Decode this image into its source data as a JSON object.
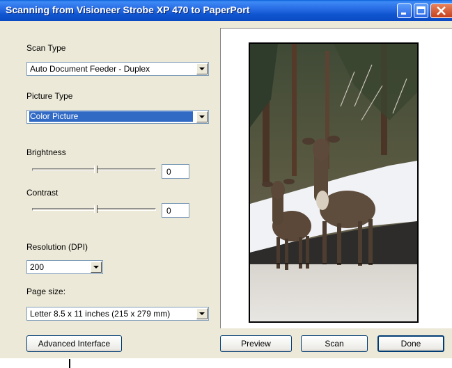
{
  "window": {
    "title": "Scanning from Visioneer Strobe XP 470 to PaperPort"
  },
  "scan_type": {
    "label": "Scan Type",
    "value": "Auto Document Feeder - Duplex"
  },
  "picture_type": {
    "label": "Picture Type",
    "value": "Color Picture"
  },
  "brightness": {
    "label": "Brightness",
    "value": "0"
  },
  "contrast": {
    "label": "Contrast",
    "value": "0"
  },
  "resolution": {
    "label": "Resolution (DPI)",
    "value": "200"
  },
  "page_size": {
    "label": "Page size:",
    "value": "Letter 8.5 x 11 inches (215 x 279 mm)"
  },
  "buttons": {
    "advanced": "Advanced Interface",
    "preview": "Preview",
    "scan": "Scan",
    "done": "Done"
  },
  "colors": {
    "title_bar": "#0a55d0",
    "highlight": "#316ac5",
    "dialog_bg": "#ece9d8"
  }
}
